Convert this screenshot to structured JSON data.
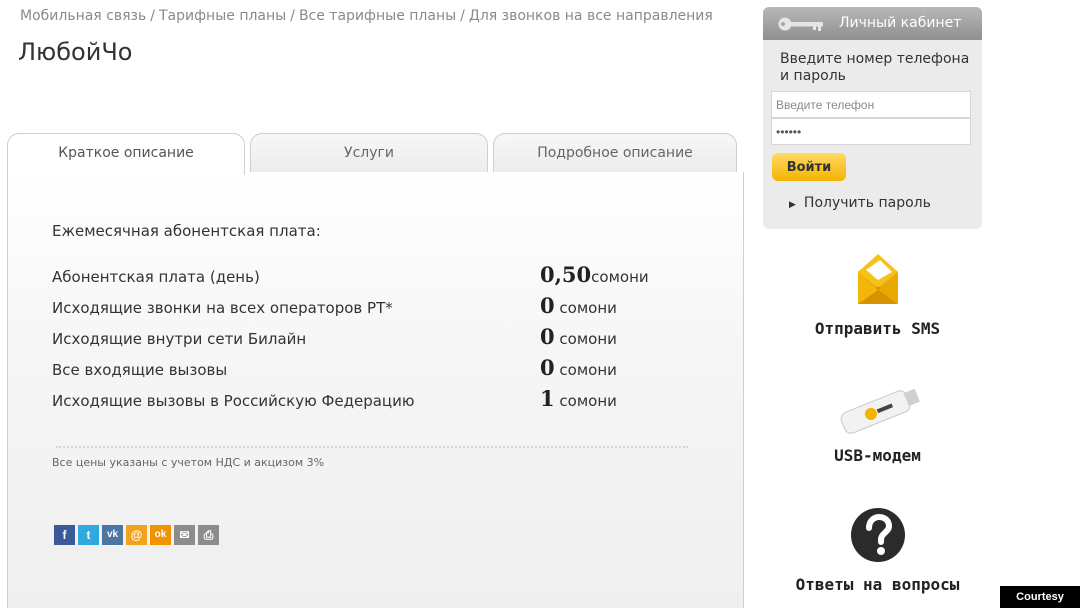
{
  "breadcrumb": [
    {
      "label": "Мобильная связь"
    },
    {
      "label": "Тарифные планы"
    },
    {
      "label": "Все тарифные планы"
    },
    {
      "label": "Для звонков на все направления"
    }
  ],
  "breadcrumb_separator": "/",
  "page_title": "ЛюбойЧо",
  "tabs": [
    {
      "label": "Краткое описание",
      "active": true
    },
    {
      "label": "Услуги",
      "active": false
    },
    {
      "label": "Подробное описание",
      "active": false
    }
  ],
  "pricing": {
    "heading": "Ежемесячная абонентская плата:",
    "rows": [
      {
        "label": "Абонентская плата (день)",
        "value": "0,50",
        "unit": "сомони"
      },
      {
        "label": "Исходящие звонки на всех операторов РТ*",
        "value": "0",
        "unit": "сомони"
      },
      {
        "label": "Исходящие внутри сети Билайн",
        "value": "0",
        "unit": "сомони"
      },
      {
        "label": "Все входящие вызовы",
        "value": "0",
        "unit": "сомони"
      },
      {
        "label": "Исходящие вызовы в Российскую Федерацию",
        "value": "1",
        "unit": "сомони"
      }
    ],
    "note": "Все цены указаны с учетом НДС и акцизом 3%"
  },
  "share_buttons": [
    {
      "name": "facebook-share-button",
      "glyph": "f",
      "color": "#3b5998"
    },
    {
      "name": "twitter-share-button",
      "glyph": "t",
      "color": "#2fa9e0"
    },
    {
      "name": "vk-share-button",
      "glyph": "vk",
      "color": "#4c75a3"
    },
    {
      "name": "mailru-share-button",
      "glyph": "@",
      "color": "#f4a21e"
    },
    {
      "name": "odnoklassniki-share-button",
      "glyph": "ok",
      "color": "#f29400"
    },
    {
      "name": "email-share-button",
      "glyph": "✉",
      "color": "#8c8c8c"
    },
    {
      "name": "print-share-button",
      "glyph": "⎙",
      "color": "#8c8c8c"
    }
  ],
  "login": {
    "title": "Личный кабинет",
    "prompt": "Введите номер телефона и пароль",
    "phone_placeholder": "Введите телефон",
    "password_value": "••••••",
    "submit_label": "Войти",
    "get_password_label": "Получить пароль"
  },
  "side_links": [
    {
      "icon": "envelope-icon",
      "caption": "Отправить SMS"
    },
    {
      "icon": "usb-modem-icon",
      "caption": "USB-модем"
    },
    {
      "icon": "question-icon",
      "caption": "Ответы на вопросы"
    }
  ],
  "credit": "Courtesy Photo",
  "colors": {
    "accent_yellow": "#f4b400",
    "login_bg": "#ebebeb",
    "header_gray": "#9d9d9d"
  }
}
